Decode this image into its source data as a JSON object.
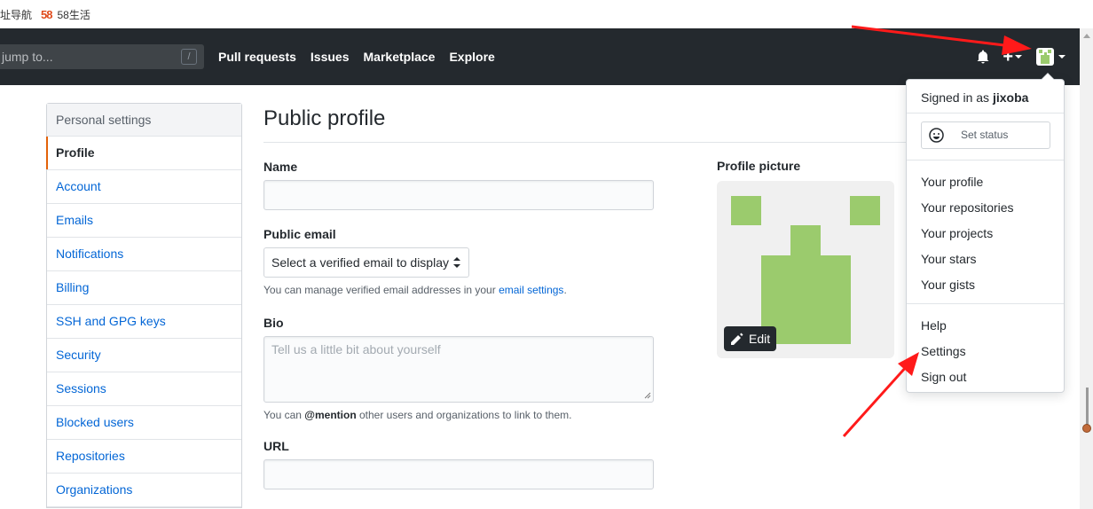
{
  "bookmarks": [
    {
      "icon": "none",
      "label": "址导航"
    },
    {
      "icon": "58-logo",
      "logo_text": "58",
      "label": "58生活"
    }
  ],
  "header": {
    "search_placeholder": "jump to...",
    "search_shortcut": "/",
    "nav": [
      "Pull requests",
      "Issues",
      "Marketplace",
      "Explore"
    ],
    "icons": [
      "bell-icon",
      "plus-icon",
      "avatar"
    ]
  },
  "sidebar": {
    "heading": "Personal settings",
    "items": [
      {
        "label": "Profile",
        "selected": true
      },
      {
        "label": "Account"
      },
      {
        "label": "Emails"
      },
      {
        "label": "Notifications"
      },
      {
        "label": "Billing"
      },
      {
        "label": "SSH and GPG keys"
      },
      {
        "label": "Security"
      },
      {
        "label": "Sessions"
      },
      {
        "label": "Blocked users"
      },
      {
        "label": "Repositories"
      },
      {
        "label": "Organizations"
      }
    ]
  },
  "main": {
    "title": "Public profile",
    "name_label": "Name",
    "name_value": "",
    "email_label": "Public email",
    "email_select": "Select a verified email to display",
    "email_note_prefix": "You can manage verified email addresses in your",
    "email_note_link": "email settings",
    "email_note_suffix": ".",
    "bio_label": "Bio",
    "bio_placeholder": "Tell us a little bit about yourself",
    "bio_note_prefix": "You can",
    "bio_note_mention": "@mention",
    "bio_note_suffix": "other users and organizations to link to them.",
    "url_label": "URL",
    "url_value": "",
    "profile_picture_label": "Profile picture",
    "edit_label": "Edit"
  },
  "dropdown": {
    "signed_in_prefix": "Signed in as",
    "username": "jixoba",
    "set_status": "Set status",
    "items_group1": [
      "Your profile",
      "Your repositories",
      "Your projects",
      "Your stars",
      "Your gists"
    ],
    "items_group2": [
      "Help",
      "Settings",
      "Sign out"
    ]
  },
  "colors": {
    "header_bg": "#24292e",
    "link": "#0366d6",
    "avatar_green": "#9bcb6d",
    "annotation_arrow": "#ff1a1a",
    "selected_marker": "#e36209"
  }
}
